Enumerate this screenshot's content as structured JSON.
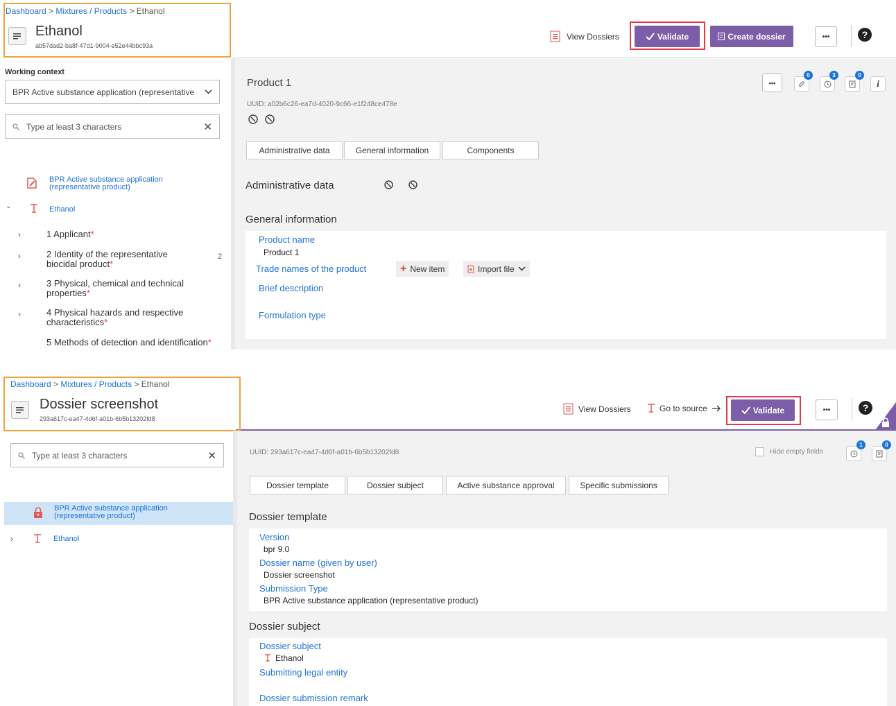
{
  "top": {
    "breadcrumb": [
      "Dashboard",
      "Mixtures / Products",
      "Ethanol"
    ],
    "title": "Ethanol",
    "uuid": "ab57dad2-ba8f-47d1-9004-e52e44bbc93a",
    "view_dossiers": "View Dossiers",
    "validate": "Validate",
    "create_dossier": "Create dossier",
    "more": "•••",
    "help": "?",
    "working_context_label": "Working context",
    "working_context_value": "BPR Active substance application (representative",
    "search_placeholder": "Type at least 3 characters",
    "tree": {
      "root_label": "BPR Active substance application (representative product)",
      "entity": "Ethanol",
      "items": [
        {
          "label": "1 Applicant"
        },
        {
          "label": "2 Identity of the representative biocidal product",
          "count": "2"
        },
        {
          "label": "3 Physical, chemical and technical properties"
        },
        {
          "label": "4 Physical hazards and respective characteristics"
        },
        {
          "label": "5 Methods of detection and identification"
        }
      ],
      "star": "*"
    },
    "doc": {
      "title": "Product 1",
      "uuid_label": "UUID:",
      "uuid": "a02b6c26-ea7d-4020-9c66-e1f248ce478e",
      "badges": [
        "0",
        "3",
        "0"
      ],
      "info": "i",
      "tabs": [
        "Administrative data",
        "General information",
        "Components"
      ],
      "admin_heading": "Administrative data",
      "general_heading": "General information",
      "fields": {
        "product_name_label": "Product name",
        "product_name_value": "Product 1",
        "trade_names_label": "Trade names of the product",
        "new_item": "New item",
        "import_file": "Import file",
        "brief_desc_label": "Brief description",
        "formulation_label": "Formulation type"
      }
    }
  },
  "bottom": {
    "breadcrumb": [
      "Dashboard",
      "Mixtures / Products",
      "Ethanol"
    ],
    "title": "Dossier screenshot",
    "uuid": "293a617c-ea47-4d6f-a01b-6b5b13202fd8",
    "view_dossiers": "View Dossiers",
    "go_to_source": "Go to source",
    "validate": "Validate",
    "more": "•••",
    "help": "?",
    "search_placeholder": "Type at least 3 characters",
    "tree": {
      "root_label": "BPR Active substance application (representative product)",
      "entity": "Ethanol"
    },
    "doc": {
      "uuid_label": "UUID:",
      "uuid": "293a617c-ea47-4d6f-a01b-6b5b13202fd8",
      "hide_empty": "Hide empty fields",
      "badges": [
        "1",
        "0"
      ],
      "tabs": [
        "Dossier template",
        "Dossier subject",
        "Active substance approval",
        "Specific submissions"
      ],
      "template_heading": "Dossier template",
      "version_label": "Version",
      "version_value": "bpr 9.0",
      "dossier_name_label": "Dossier name (given by user)",
      "dossier_name_value": "Dossier screenshot",
      "submission_type_label": "Submission Type",
      "submission_type_value": "BPR Active substance application (representative product)",
      "subject_heading": "Dossier subject",
      "subject_label": "Dossier subject",
      "subject_value": "Ethanol",
      "legal_entity_label": "Submitting legal entity",
      "remark_label": "Dossier submission remark"
    }
  },
  "colors": {
    "accent_purple": "#7b5ea7",
    "link_blue": "#1e73d8",
    "highlight_orange": "#f0a23b",
    "highlight_red": "#e53945"
  }
}
